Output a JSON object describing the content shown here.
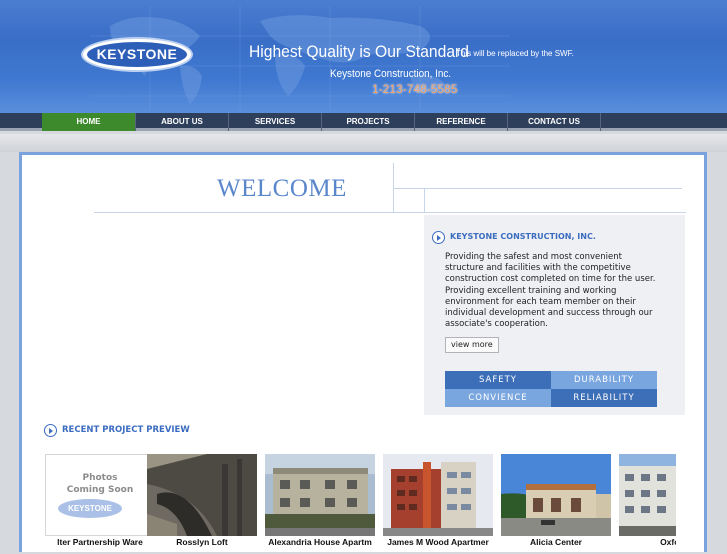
{
  "header": {
    "logo_text": "KEYSTONE",
    "slogan": "Highest Quality is Our Standard",
    "swf_note": "This will be replaced by the SWF.",
    "company": "Keystone Construction, Inc.",
    "phone": "1-213-748-5585"
  },
  "nav": {
    "items": [
      {
        "label": "HOME",
        "active": true
      },
      {
        "label": "ABOUT US"
      },
      {
        "label": "SERVICES"
      },
      {
        "label": "PROJECTS"
      },
      {
        "label": "REFERENCE"
      },
      {
        "label": "CONTACT US"
      }
    ]
  },
  "main": {
    "welcome": "WELCOME",
    "info": {
      "title": "KEYSTONE CONSTRUCTION, INC.",
      "text": "Providing the safest and most convenient structure and facilities with the competitive construction cost completed on time for the user. Providing excellent training and working environment for each team member on their individual development and success through our associate's cooperation.",
      "view_more": "view more",
      "values": [
        "SAFETY",
        "DURABILITY",
        "CONVIENCE",
        "RELIABILITY"
      ]
    },
    "recent": {
      "title": "RECENT PROJECT PREVIEW",
      "placeholder_line1": "Photos",
      "placeholder_line2": "Coming Soon",
      "placeholder_logo": "KEYSTONE",
      "projects": [
        {
          "caption": "lter Partnership Ware"
        },
        {
          "caption": "Rosslyn Loft"
        },
        {
          "caption": "Alexandria House Apartm"
        },
        {
          "caption": "James M Wood Apartmer"
        },
        {
          "caption": "Alicia Center"
        },
        {
          "caption": "Oxford"
        }
      ]
    }
  },
  "colors": {
    "header_blue": "#3a6ec7",
    "nav_dark": "#2e3f5c",
    "nav_active": "#3c8a2c",
    "accent": "#3b6cc0",
    "tile_dark": "#3d6fb8",
    "tile_light": "#7aa6e0"
  }
}
